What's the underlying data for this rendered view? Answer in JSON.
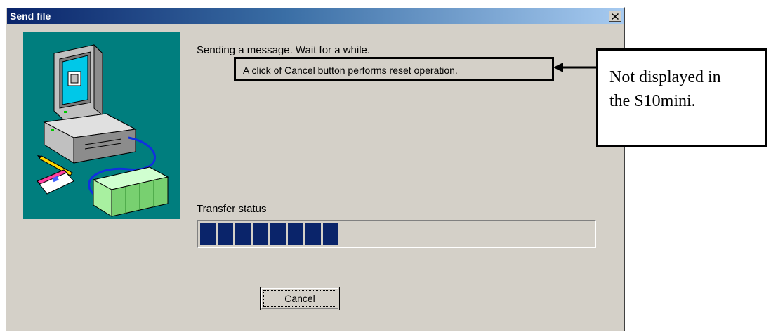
{
  "window": {
    "title": "Send file",
    "close_glyph": "✕"
  },
  "message": "Sending a message. Wait for a while.",
  "cancel_note": "A click of Cancel button performs reset operation.",
  "transfer": {
    "label": "Transfer status",
    "progress_blocks_filled": 8,
    "progress_percent": 35,
    "bar_color": "#0a246a"
  },
  "buttons": {
    "cancel_label": "Cancel"
  },
  "annotation": {
    "line1": "Not displayed in",
    "line2": "the S10mini."
  },
  "illustration": {
    "icons": [
      "computer-monitor-icon",
      "pencil-icon",
      "notepad-icon",
      "plc-unit-icon",
      "cable-icon"
    ],
    "background_color": "#007e7e"
  }
}
